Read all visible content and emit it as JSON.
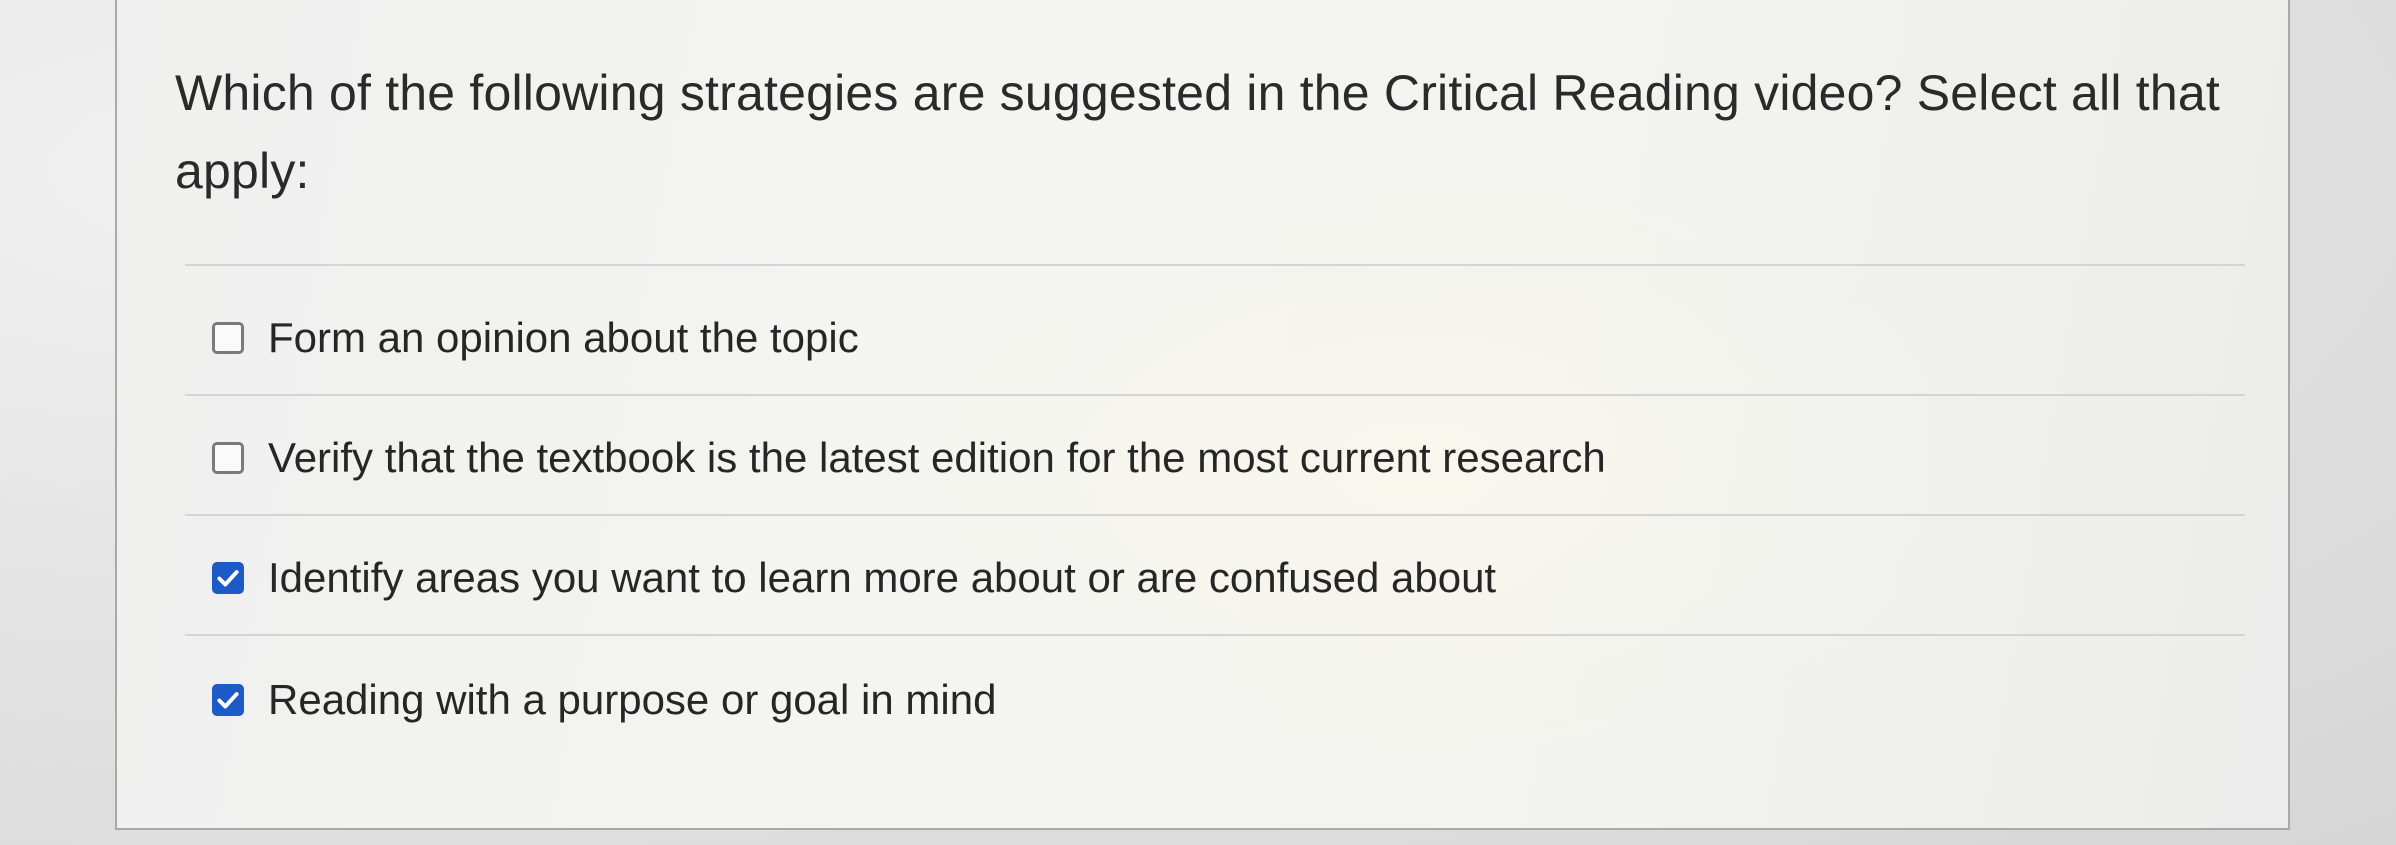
{
  "question": {
    "text": "Which of the following strategies are suggested in the Critical Reading video? Select all that apply:"
  },
  "options": [
    {
      "label": "Form an opinion about the topic",
      "checked": false
    },
    {
      "label": "Verify that the textbook is the latest edition for the most current research",
      "checked": false
    },
    {
      "label": "Identify areas you want to learn more about or are confused about",
      "checked": true
    },
    {
      "label": "Reading with a purpose or goal in mind",
      "checked": true
    }
  ],
  "colors": {
    "checkbox_checked": "#1c5bc7",
    "checkbox_border": "#7a7a7a",
    "text": "#262626"
  },
  "icons": {
    "checked": "checkmark-icon"
  }
}
